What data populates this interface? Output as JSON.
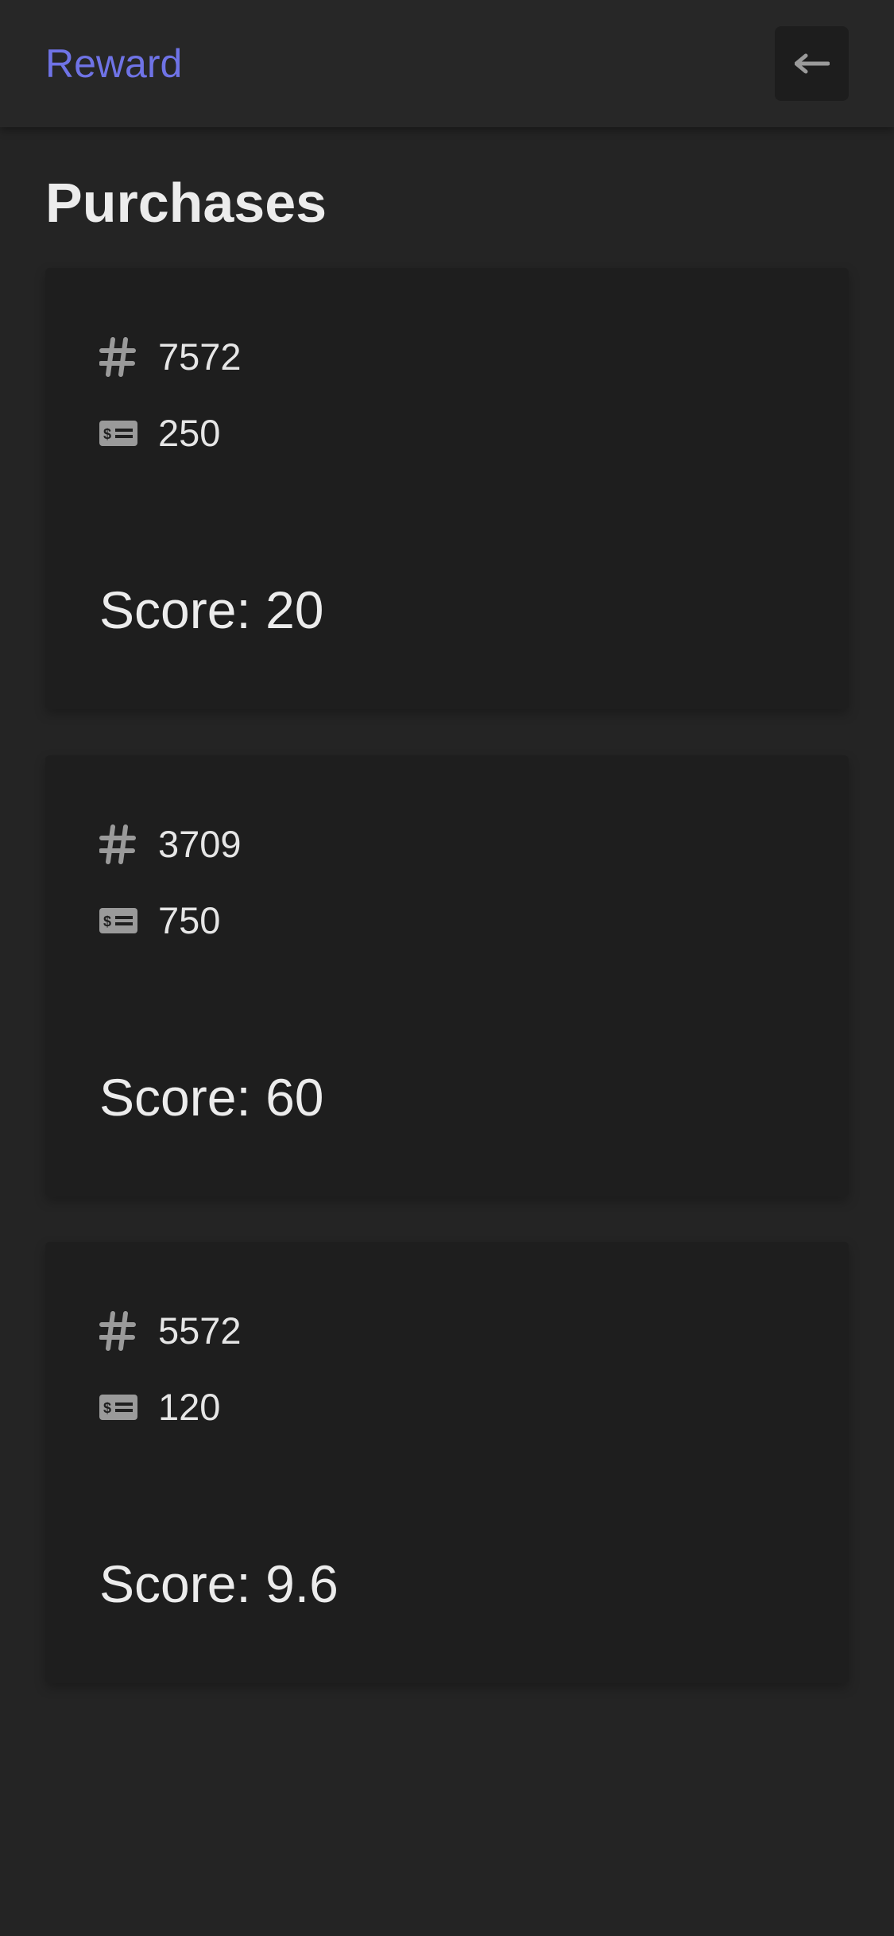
{
  "header": {
    "brand": "Reward",
    "back_icon": "arrow-left-icon"
  },
  "page": {
    "title": "Purchases"
  },
  "purchases": [
    {
      "id": "7572",
      "amount": "250",
      "score": "Score: 20"
    },
    {
      "id": "3709",
      "amount": "750",
      "score": "Score: 60"
    },
    {
      "id": "5572",
      "amount": "120",
      "score": "Score: 9.6"
    }
  ],
  "icons": {
    "id": "hash-icon",
    "amount": "money-bill-icon"
  },
  "colors": {
    "accent": "#6f73e6",
    "background": "#242424",
    "card": "#1e1e1e",
    "icon": "#9a9a9a"
  }
}
